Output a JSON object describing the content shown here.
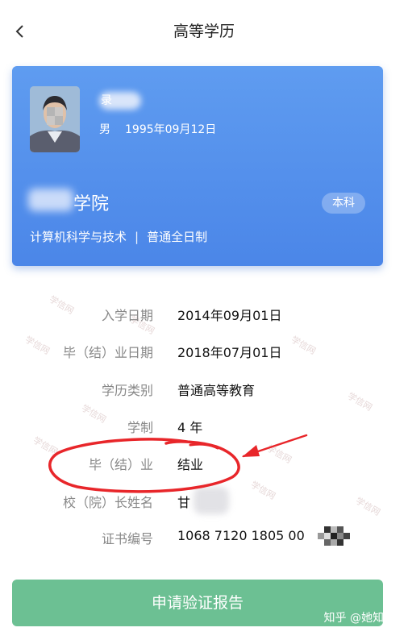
{
  "header": {
    "back_icon": "chevron-left-icon",
    "title": "高等学历"
  },
  "card": {
    "name_mark": "录",
    "gender": "男",
    "birth": "1995年09月12日",
    "school": "学院",
    "degree_badge": "本科",
    "major": "计算机科学与技术",
    "separator": "|",
    "study_form": "普通全日制"
  },
  "info": {
    "enrollment_label": "入学日期",
    "enrollment_value": "2014年09月01日",
    "graduation_label": "毕（结）业日期",
    "graduation_value": "2018年07月01日",
    "category_label": "学历类别",
    "category_value": "普通高等教育",
    "duration_label": "学制",
    "duration_value": "4 年",
    "status_label": "毕（结）业",
    "status_value": "结业",
    "principal_label": "校（院）长姓名",
    "principal_value": "甘",
    "cert_label": "证书编号",
    "cert_value": "1068 7120 1805 00"
  },
  "footer": {
    "verify_button": "申请验证报告",
    "watermark_credit": "知乎 @她知道"
  },
  "colors": {
    "card_blue": "#5a96ee",
    "button_green": "#6cc093",
    "annotation_red": "#e8262a"
  }
}
